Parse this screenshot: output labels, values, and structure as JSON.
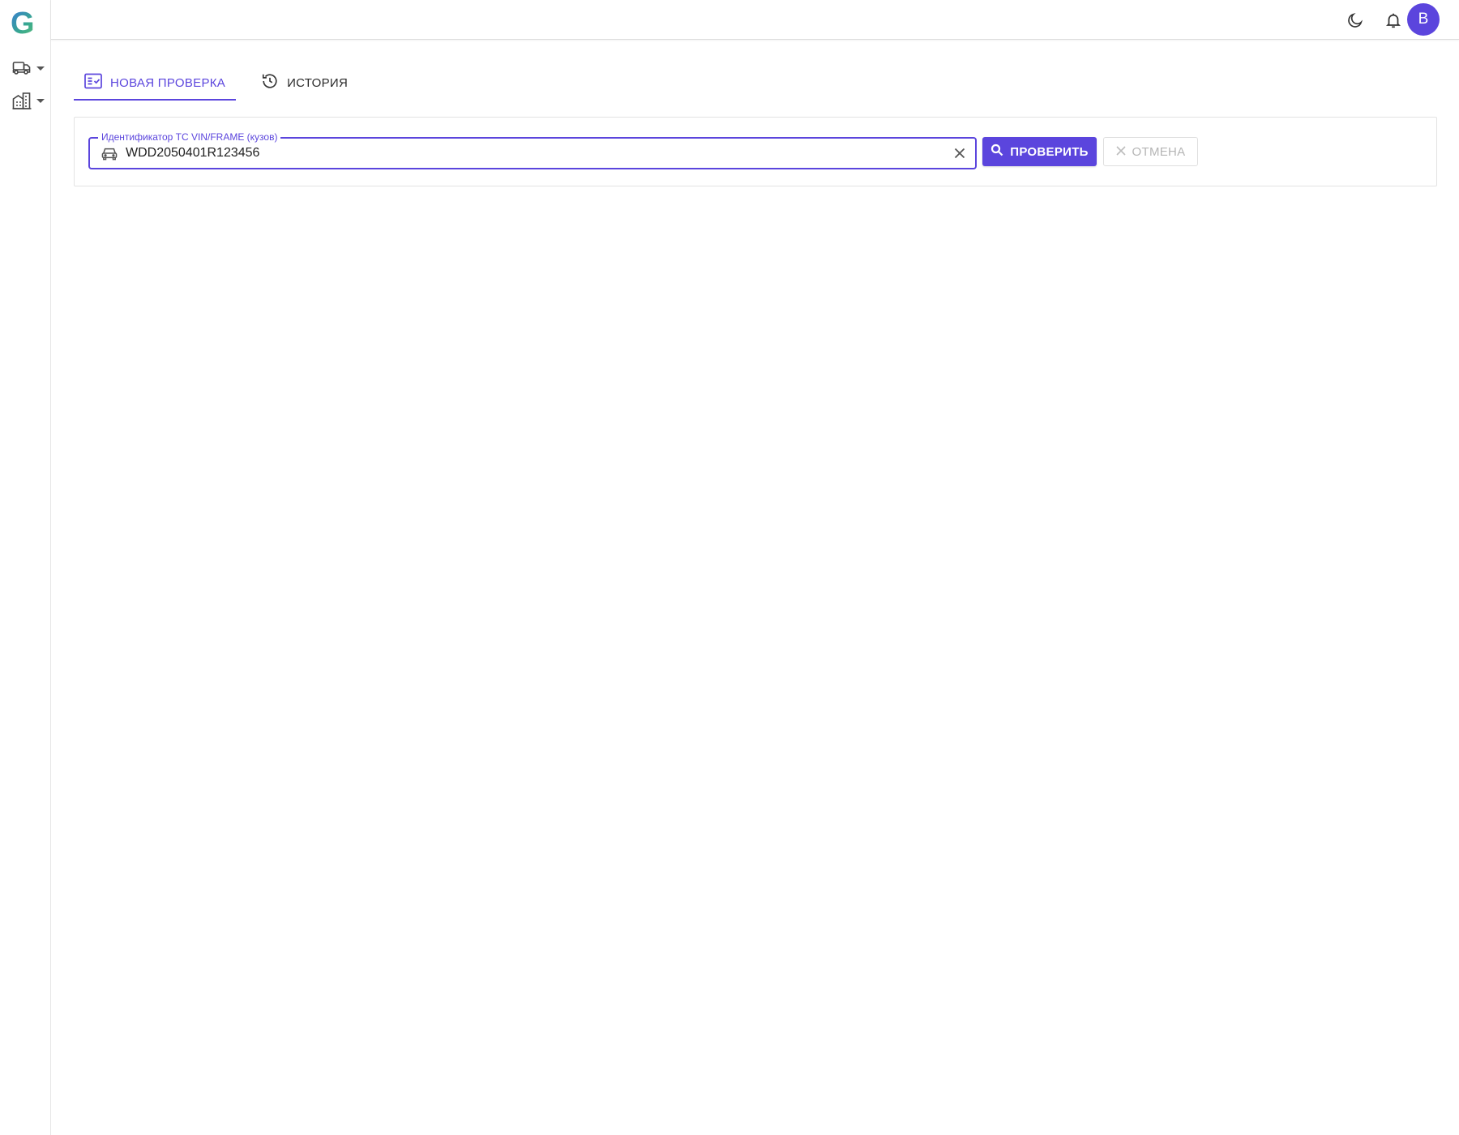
{
  "app": {
    "logo_letter": "G",
    "brand_color": "#5b45dd"
  },
  "sidebar": {
    "items": [
      {
        "icon": "vehicles-icon"
      },
      {
        "icon": "buildings-icon"
      }
    ]
  },
  "header": {
    "icons": [
      "dark-mode-icon",
      "notifications-icon"
    ],
    "avatar_letter": "В"
  },
  "tabs": [
    {
      "label": "НОВАЯ ПРОВЕРКА",
      "icon": "checklist-icon",
      "active": true
    },
    {
      "label": "ИСТОРИЯ",
      "icon": "history-icon",
      "active": false
    }
  ],
  "form": {
    "field_label": "Идентификатор ТС VIN/FRAME (кузов)",
    "field_value": "WDD2050401R123456",
    "check_label": "ПРОВЕРИТЬ",
    "cancel_label": "ОТМЕНА"
  }
}
